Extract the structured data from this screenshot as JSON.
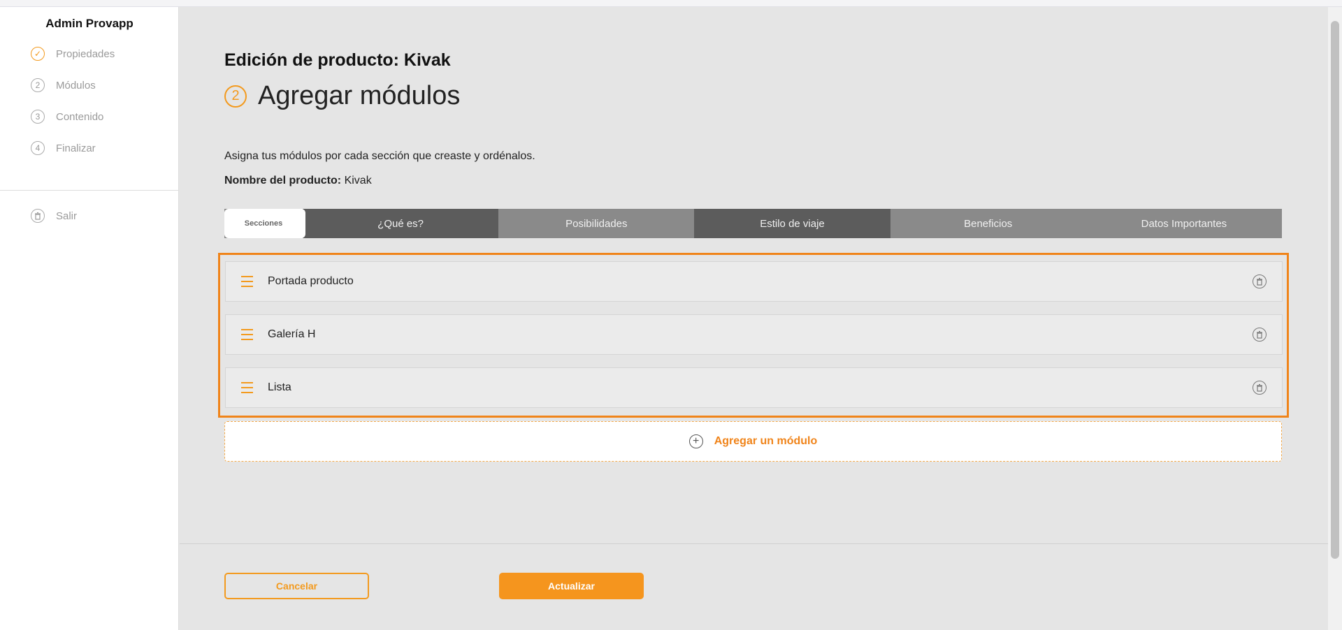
{
  "sidebar": {
    "title": "Admin Provapp",
    "items": [
      {
        "step": "✓",
        "label": "Propiedades"
      },
      {
        "step": "2",
        "label": "Módulos"
      },
      {
        "step": "3",
        "label": "Contenido"
      },
      {
        "step": "4",
        "label": "Finalizar"
      }
    ],
    "logout_label": "Salir"
  },
  "header": {
    "title": "Edición de producto: Kivak",
    "step_number": "2",
    "step_title": "Agregar módulos"
  },
  "description": "Asigna tus módulos por cada sección que creaste y ordénalos.",
  "product_name": {
    "label": "Nombre del producto:",
    "value": "Kivak"
  },
  "tabs": {
    "first_label": "Secciones",
    "items": [
      "¿Qué es?",
      "Posibilidades",
      "Estilo de viaje",
      "Beneficios",
      "Datos Importantes"
    ]
  },
  "modules": [
    {
      "label": "Portada producto"
    },
    {
      "label": "Galería H"
    },
    {
      "label": "Lista"
    }
  ],
  "add_module_label": "Agregar un módulo",
  "footer": {
    "cancel_label": "Cancelar",
    "update_label": "Actualizar"
  },
  "colors": {
    "accent": "#f39a1e",
    "highlight_border": "#f0841a",
    "tab_dark": "#5c5c5c",
    "tab_light": "#8a8a8a"
  }
}
